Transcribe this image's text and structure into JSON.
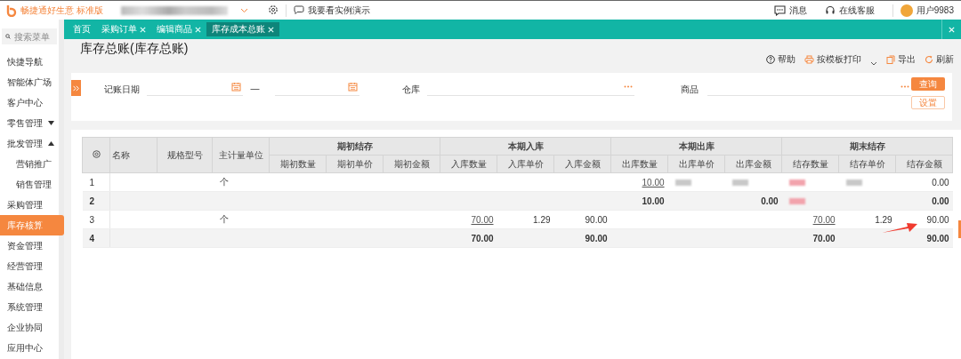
{
  "topbar": {
    "brand": "畅捷通好生意",
    "edition": "标准版",
    "demo_link": "我要看实例演示",
    "actions": [
      {
        "kind": "message",
        "label": "消息"
      },
      {
        "kind": "service",
        "label": "在线客服"
      }
    ],
    "user": "用户9983"
  },
  "sidebar": {
    "search": {
      "placeholder": "搜索菜单"
    },
    "items": [
      {
        "label": "快捷导航",
        "selected": false
      },
      {
        "label": "智能体广场",
        "selected": false
      },
      {
        "label": "客户中心",
        "selected": false
      },
      {
        "label": "零售管理",
        "selected": false,
        "expanded": false
      },
      {
        "label": "批发管理",
        "selected": false,
        "expanded": true,
        "children": [
          {
            "label": "营销推广",
            "selected": false
          },
          {
            "label": "销售管理",
            "selected": false
          }
        ]
      },
      {
        "label": "采购管理",
        "selected": false
      },
      {
        "label": "库存核算",
        "selected": true
      },
      {
        "label": "资金管理",
        "selected": false
      },
      {
        "label": "经营管理",
        "selected": false
      },
      {
        "label": "基础信息",
        "selected": false
      },
      {
        "label": "系统管理",
        "selected": false
      },
      {
        "label": "企业协同",
        "selected": false
      },
      {
        "label": "应用中心",
        "selected": false
      }
    ]
  },
  "tabs": [
    {
      "label": "首页",
      "closable": false,
      "selected": false
    },
    {
      "label": "采购订单",
      "closable": true,
      "selected": false
    },
    {
      "label": "编辑商品",
      "closable": true,
      "selected": false
    },
    {
      "label": "库存成本总账",
      "closable": true,
      "selected": true
    }
  ],
  "page": {
    "title": "库存总账(库存总账)",
    "toolbar": [
      {
        "kind": "help",
        "label": "帮助"
      },
      {
        "kind": "print",
        "label": "按模板打印",
        "dropdown": true
      },
      {
        "kind": "export",
        "label": "导出"
      },
      {
        "kind": "refresh",
        "label": "刷新"
      }
    ]
  },
  "filters": {
    "date_label": "记账日期",
    "date_separator": "—",
    "warehouse_label": "仓库",
    "product_label": "商品",
    "query_button": "查询",
    "settings_button": "设置"
  },
  "table": {
    "fixed_columns": [
      "名称",
      "规格型号",
      "主计量单位"
    ],
    "groups": [
      {
        "label": "期初结存",
        "columns": [
          "期初数量",
          "期初单价",
          "期初金额"
        ]
      },
      {
        "label": "本期入库",
        "columns": [
          "入库数量",
          "入库单价",
          "入库金额"
        ]
      },
      {
        "label": "本期出库",
        "columns": [
          "出库数量",
          "出库单价",
          "出库金额"
        ]
      },
      {
        "label": "期末结存",
        "columns": [
          "结存数量",
          "结存单价",
          "结存金额"
        ]
      }
    ],
    "rows": [
      {
        "no": "1",
        "kind": "detail",
        "unit": "个",
        "cells": [
          null,
          null,
          null,
          null,
          null,
          null,
          {
            "text": "10.00",
            "link": true
          },
          {
            "redacted": true,
            "color": "#c8c8c8"
          },
          {
            "redacted": true,
            "color": "#c8c8c8"
          },
          {
            "redacted": true,
            "color": "#f2a3ac"
          },
          {
            "redacted": true,
            "color": "#c8c8c8"
          },
          {
            "text": "0.00",
            "link": false
          }
        ]
      },
      {
        "no": "2",
        "kind": "subtotal",
        "cells": [
          null,
          null,
          null,
          null,
          null,
          null,
          {
            "text": "10.00",
            "link": false
          },
          null,
          {
            "text": "0.00",
            "link": false
          },
          {
            "redacted": true,
            "color": "#f2a3ac"
          },
          null,
          {
            "text": "0.00",
            "link": false
          }
        ]
      },
      {
        "no": "3",
        "kind": "detail",
        "unit": "个",
        "cells": [
          null,
          null,
          null,
          {
            "text": "70.00",
            "link": true
          },
          {
            "text": "1.29",
            "link": false
          },
          {
            "text": "90.00",
            "link": false
          },
          null,
          null,
          null,
          {
            "text": "70.00",
            "link": true
          },
          {
            "text": "1.29",
            "link": false
          },
          {
            "text": "90.00",
            "link": false
          }
        ]
      },
      {
        "no": "4",
        "kind": "subtotal",
        "cells": [
          null,
          null,
          null,
          {
            "text": "70.00",
            "link": false
          },
          null,
          {
            "text": "90.00",
            "link": false
          },
          null,
          null,
          null,
          {
            "text": "70.00",
            "link": false
          },
          null,
          {
            "text": "90.00",
            "link": false
          }
        ]
      }
    ]
  }
}
